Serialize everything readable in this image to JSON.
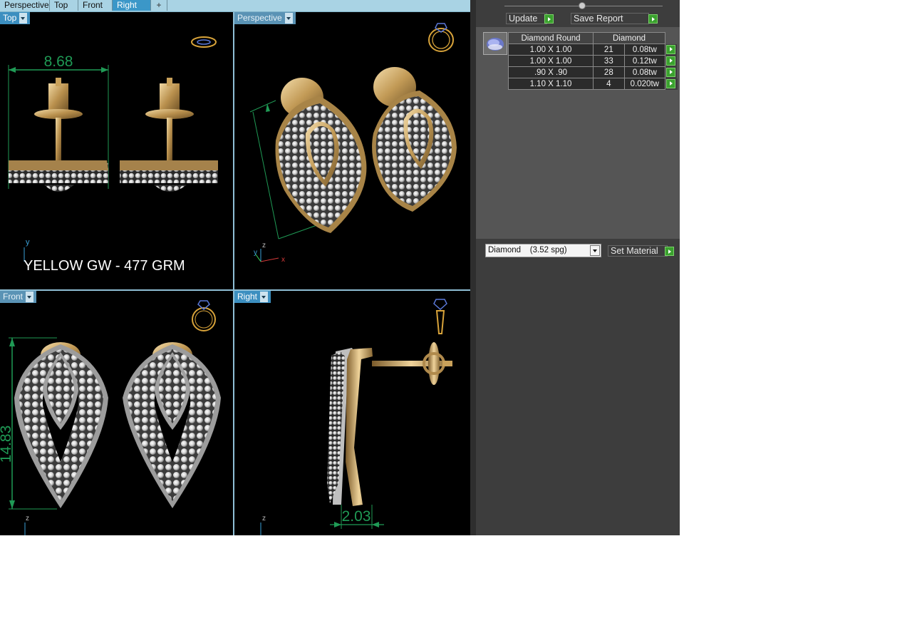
{
  "tabs": [
    {
      "label": "Perspective",
      "active": false
    },
    {
      "label": "Top",
      "active": false
    },
    {
      "label": "Front",
      "active": false
    },
    {
      "label": "Right",
      "active": true
    }
  ],
  "tab_add_symbol": "+",
  "viewports": {
    "top": {
      "label": "Top",
      "dimension": "8.68",
      "axis": "y",
      "caption": "YELLOW GW - 477 GRM"
    },
    "perspective": {
      "label": "Perspective",
      "axis_z": "z",
      "axis_y": "y",
      "axis_x": "x"
    },
    "front": {
      "label": "Front",
      "dimension": "14.83",
      "axis": "z"
    },
    "right": {
      "label": "Right",
      "dimension": "2.03",
      "axis": "z"
    }
  },
  "panel": {
    "update_label": "Update",
    "save_report_label": "Save Report",
    "diamond_table": {
      "headers": [
        "Diamond Round",
        "Diamond"
      ],
      "rows": [
        {
          "size": "1.00 X 1.00",
          "count": "21",
          "weight": "0.08tw"
        },
        {
          "size": "1.00 X 1.00",
          "count": "33",
          "weight": "0.12tw"
        },
        {
          "size": ".90 X .90",
          "count": "28",
          "weight": "0.08tw"
        },
        {
          "size": "1.10 X 1.10",
          "count": "4",
          "weight": "0.020tw"
        }
      ]
    },
    "material_value": "Diamond    (3.52 spg)",
    "set_material_label": "Set Material"
  },
  "colors": {
    "viewport_bg": "#000000",
    "tab_bar": "#a9d3e4",
    "tab_active": "#3b97c8",
    "dimension_green": "#1f9a55",
    "gold": "#c9a15a",
    "panel_bg": "#3d3d3d",
    "go_button": "#3aa12e"
  }
}
